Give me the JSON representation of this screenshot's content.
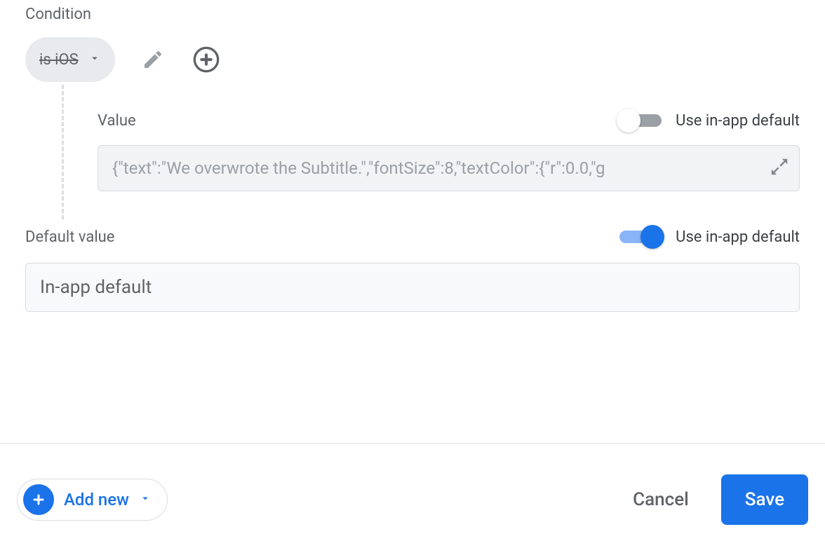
{
  "condition": {
    "label": "Condition",
    "chip_text": "is iOS"
  },
  "value_section": {
    "label": "Value",
    "toggle_label": "Use in-app default",
    "toggle_on": false,
    "input_value": "{\"text\":\"We overwrote the Subtitle.\",\"fontSize\":8,\"textColor\":{\"r\":0.0,\"g"
  },
  "default_section": {
    "label": "Default value",
    "toggle_label": "Use in-app default",
    "toggle_on": true,
    "input_value": "In-app default"
  },
  "footer": {
    "add_new": "Add new",
    "cancel": "Cancel",
    "save": "Save"
  }
}
